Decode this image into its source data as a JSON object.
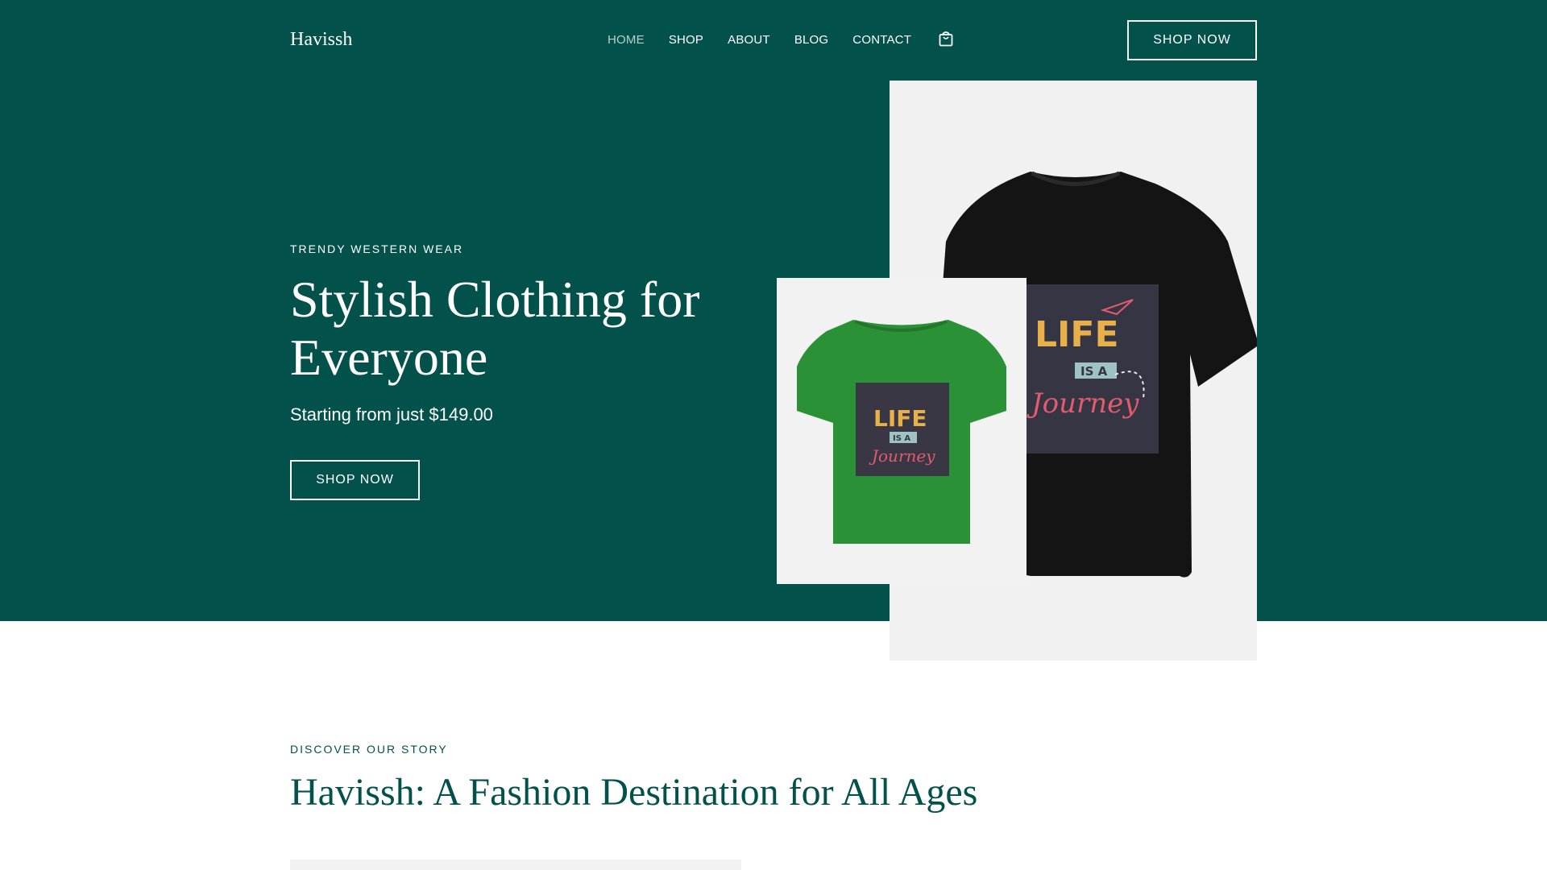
{
  "colors": {
    "brand_green": "#03514b",
    "white": "#ffffff",
    "light_gray": "#f2f2f2"
  },
  "header": {
    "brand": "Havissh",
    "nav": [
      "HOME",
      "SHOP",
      "ABOUT",
      "BLOG",
      "CONTACT"
    ],
    "active_nav": "HOME",
    "cart_icon": "shopping-bag-icon",
    "cta": "SHOP NOW"
  },
  "hero": {
    "eyebrow": "TRENDY WESTERN WEAR",
    "title": "Stylish Clothing for Everyone",
    "subtitle": "Starting from just $149.00",
    "cta": "SHOP NOW"
  },
  "product_images": {
    "large": {
      "shirt_color": "black",
      "print_lines": [
        "LIFE",
        "IS A",
        "Journey"
      ]
    },
    "small": {
      "shirt_color": "green",
      "print_lines": [
        "LIFE",
        "IS A",
        "Journey"
      ]
    }
  },
  "story": {
    "eyebrow": "DISCOVER OUR STORY",
    "title": "Havissh: A Fashion Destination for All Ages"
  }
}
